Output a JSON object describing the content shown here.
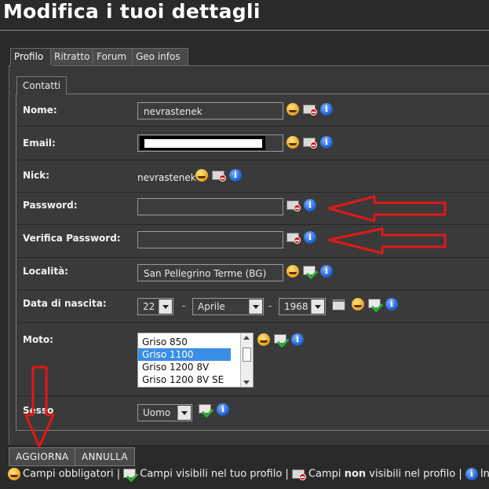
{
  "page": {
    "title": "Modifica i tuoi dettagli"
  },
  "tabs": [
    "Profilo",
    "Ritratto",
    "Forum",
    "Geo infos"
  ],
  "subtab": "Contatti",
  "form": {
    "nome": {
      "label": "Nome:",
      "value": "nevrastenek"
    },
    "email": {
      "label": "Email:",
      "value": ""
    },
    "nick": {
      "label": "Nick:",
      "value": "nevrastenek"
    },
    "password": {
      "label": "Password:",
      "value": ""
    },
    "verifica": {
      "label": "Verifica Password:",
      "value": ""
    },
    "localita": {
      "label": "Località:",
      "value": "San Pellegrino Terme (BG)"
    },
    "nascita": {
      "label": "Data di nascita:",
      "day": "22",
      "month": "Aprile",
      "year": "1968",
      "sep": "-"
    },
    "moto": {
      "label": "Moto:",
      "options": [
        "Griso 850",
        "Griso 1100",
        "Griso 1200 8V",
        "Griso 1200 8V SE"
      ],
      "selected": "Griso 1100"
    },
    "sesso": {
      "label": "Sesso",
      "value": "Uomo"
    }
  },
  "buttons": {
    "aggiorna": "AGGIORNA",
    "annulla": "ANNULLA"
  },
  "legend": {
    "obbligatori": "Campi obbligatori |",
    "visibili": "Campi visibili nel tuo profilo |",
    "non_pre": "Campi",
    "non_bold": "non",
    "non_post": "visibili nel profilo |",
    "info": "Inform"
  },
  "colors": {
    "annotation_arrow": "#e01818",
    "selected_option": "#3a8ee6"
  }
}
